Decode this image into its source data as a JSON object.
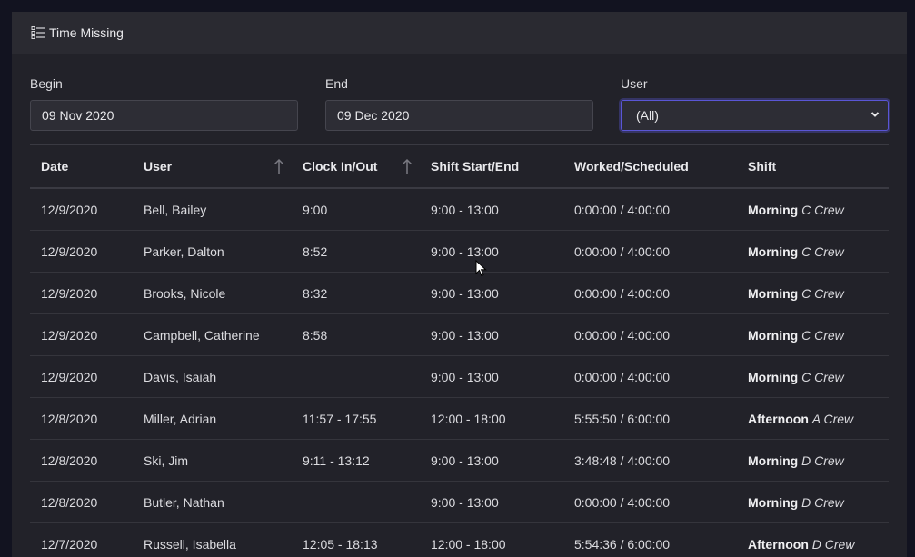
{
  "panel": {
    "title": "Time Missing",
    "title_icon": "list-icon"
  },
  "filters": {
    "begin_label": "Begin",
    "begin_value": "09 Nov 2020",
    "end_label": "End",
    "end_value": "09 Dec 2020",
    "user_label": "User",
    "user_value": "(All)"
  },
  "table": {
    "headers": [
      "Date",
      "User",
      "Clock In/Out",
      "Shift Start/End",
      "Worked/Scheduled",
      "Shift"
    ],
    "rows": [
      {
        "date": "12/9/2020",
        "user": "Bell, Bailey",
        "clock": "9:00",
        "shift_time": "9:00 - 13:00",
        "worked": "0:00:00 / 4:00:00",
        "shift": "Morning",
        "crew": "C Crew"
      },
      {
        "date": "12/9/2020",
        "user": "Parker, Dalton",
        "clock": "8:52",
        "shift_time": "9:00 - 13:00",
        "worked": "0:00:00 / 4:00:00",
        "shift": "Morning",
        "crew": "C Crew"
      },
      {
        "date": "12/9/2020",
        "user": "Brooks, Nicole",
        "clock": "8:32",
        "shift_time": "9:00 - 13:00",
        "worked": "0:00:00 / 4:00:00",
        "shift": "Morning",
        "crew": "C Crew"
      },
      {
        "date": "12/9/2020",
        "user": "Campbell, Catherine",
        "clock": "8:58",
        "shift_time": "9:00 - 13:00",
        "worked": "0:00:00 / 4:00:00",
        "shift": "Morning",
        "crew": "C Crew"
      },
      {
        "date": "12/9/2020",
        "user": "Davis, Isaiah",
        "clock": "",
        "shift_time": "9:00 - 13:00",
        "worked": "0:00:00 / 4:00:00",
        "shift": "Morning",
        "crew": "C Crew"
      },
      {
        "date": "12/8/2020",
        "user": "Miller, Adrian",
        "clock": "11:57 - 17:55",
        "shift_time": "12:00 - 18:00",
        "worked": "5:55:50 / 6:00:00",
        "shift": "Afternoon",
        "crew": "A Crew"
      },
      {
        "date": "12/8/2020",
        "user": "Ski, Jim",
        "clock": "9:11 - 13:12",
        "shift_time": "9:00 - 13:00",
        "worked": "3:48:48 / 4:00:00",
        "shift": "Morning",
        "crew": "D Crew"
      },
      {
        "date": "12/8/2020",
        "user": "Butler, Nathan",
        "clock": "",
        "shift_time": "9:00 - 13:00",
        "worked": "0:00:00 / 4:00:00",
        "shift": "Morning",
        "crew": "D Crew"
      },
      {
        "date": "12/7/2020",
        "user": "Russell, Isabella",
        "clock": "12:05 - 18:13",
        "shift_time": "12:00 - 18:00",
        "worked": "5:54:36 / 6:00:00",
        "shift": "Afternoon",
        "crew": "D Crew"
      }
    ]
  }
}
